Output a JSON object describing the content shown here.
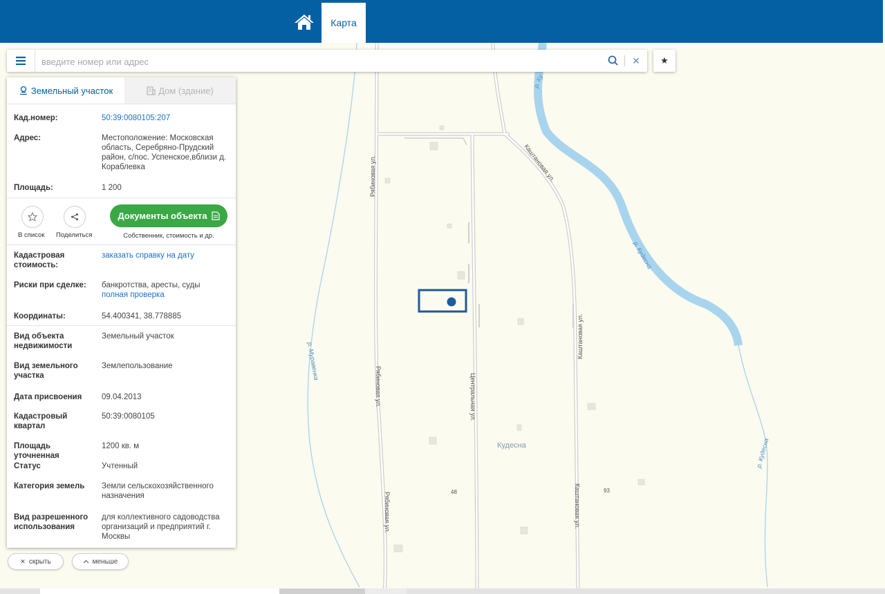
{
  "topbar": {
    "tab_label": "Карта",
    "home_icon": "home-icon",
    "bg_color": "#0560a3"
  },
  "search": {
    "placeholder": "введите номер или адрес",
    "value": ""
  },
  "panel": {
    "tab_land": "Земельный участок",
    "tab_house": "Дом (здание)",
    "cad_number": {
      "label": "Кад.номер:",
      "value": "50:39:0080105:207"
    },
    "address": {
      "label": "Адрес:",
      "value": "Местоположение: Московская область, Серебряно-Прудский район, с/пос. Успенское,вблизи д. Кораблевка"
    },
    "area": {
      "label": "Площадь:",
      "value": "1 200"
    },
    "actions": {
      "to_list": "В список",
      "share": "Поделиться",
      "documents": "Документы объекта",
      "documents_sub": "Собственник, стоимость и др."
    },
    "cad_cost": {
      "label": "Кадастровая стоимость:",
      "value": "заказать справку на дату"
    },
    "risks": {
      "label": "Риски при сделке:",
      "value": "банкротства, аресты, суды",
      "link": "полная проверка"
    },
    "coords": {
      "label": "Координаты:",
      "value": "54.400341, 38.778885"
    },
    "object_type": {
      "label": "Вид объекта недвижимости",
      "value": "Земельный участок"
    },
    "land_type": {
      "label": "Вид земельного участка",
      "value": "Землепользование"
    },
    "date_assigned": {
      "label": "Дата присвоения",
      "value": "09.04.2013"
    },
    "cad_quarter": {
      "label": "Кадастровый квартал",
      "value": "50:39:0080105"
    },
    "area_spec": {
      "label": "Площадь уточненная",
      "value": "1200 кв. м"
    },
    "status": {
      "label": "Статус",
      "value": "Учтенный"
    },
    "land_category": {
      "label": "Категория земель",
      "value": "Земли сельскохозяйственного назначения"
    },
    "permitted_use": {
      "label": "Вид разрешенного использования",
      "value": "для коллективного садоводства организаций и предприятий г. Москвы"
    }
  },
  "buttons": {
    "hide": "скрыть",
    "less": "меньше"
  },
  "map": {
    "street_ryabinovaya": "Рябиновая ул.",
    "street_kashtanovaya": "Каштановая ул.",
    "street_tsentralnaya": "Центральная ул.",
    "river_kudesna": "р. Кудесна",
    "river_muravenka": "р. Муравенка",
    "village": "Кудесна",
    "house_48": "48",
    "house_93": "93",
    "river_top": "р. Ку",
    "colors": {
      "background": "#fbfbef",
      "river": "#a8d4ee",
      "road": "#c8c8c8",
      "parcel": "#1e5a9e"
    }
  }
}
